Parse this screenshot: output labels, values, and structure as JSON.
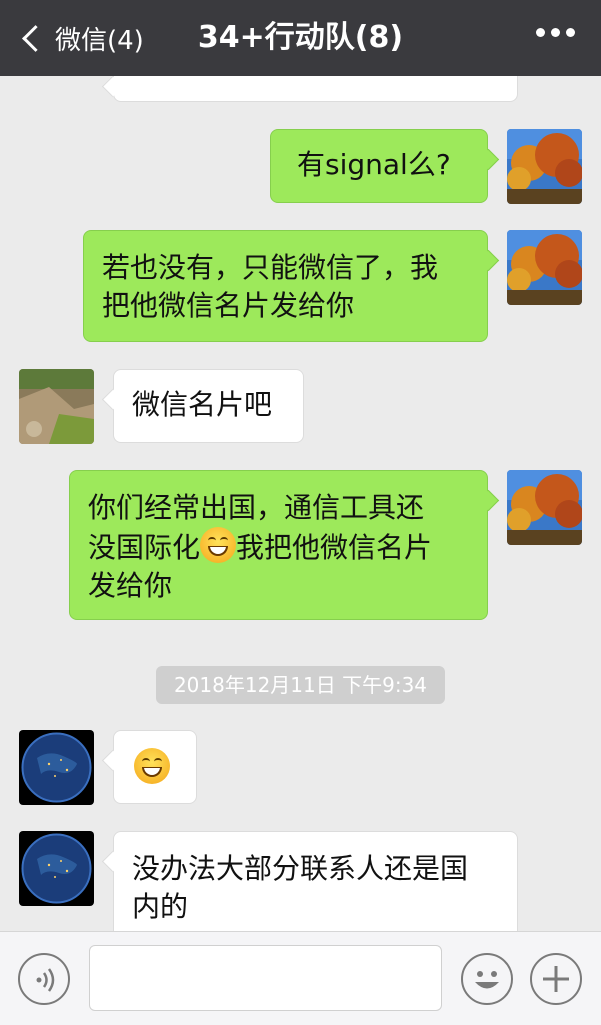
{
  "header": {
    "back_label": "微信(4)",
    "title": "34+行动队(8)"
  },
  "messages": [
    {
      "sender": "me",
      "text": "有signal么?"
    },
    {
      "sender": "me",
      "lines": [
        "若也没有，只能微信了，我",
        "把他微信名片发给你"
      ]
    },
    {
      "sender": "other",
      "text": "微信名片吧"
    },
    {
      "sender": "me",
      "lines": [
        "你们经常出国，通信工具还",
        "没国际化",
        "我把他微信名片",
        "发给你"
      ],
      "emoji": "grinning-face"
    },
    {
      "sender": "other",
      "emoji": "grinning-face"
    },
    {
      "sender": "other",
      "lines": [
        "没办法大部分联系人还是国",
        "内的"
      ]
    }
  ],
  "timestamp": "2018年12月11日 下午9:34",
  "input": {
    "placeholder": ""
  },
  "colors": {
    "header_bg": "#3a3a3e",
    "my_bubble": "#9de95b",
    "chat_bg": "#ebebeb"
  }
}
